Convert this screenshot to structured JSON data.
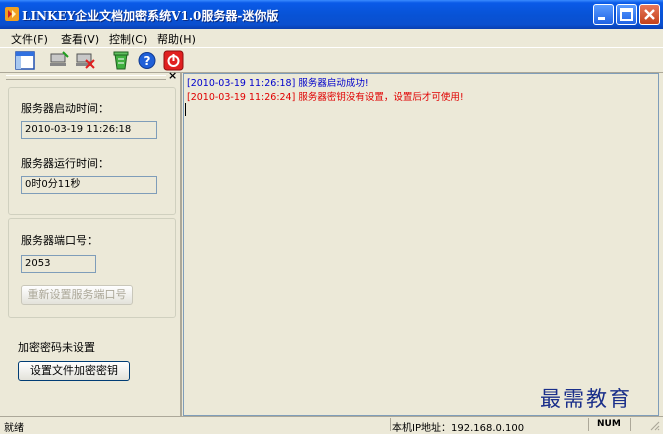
{
  "window": {
    "title": "LINKEY企业文档加密系统V1.0服务器-迷你版"
  },
  "menu": [
    {
      "label": "文件(F)"
    },
    {
      "label": "查看(V)"
    },
    {
      "label": "控制(C)"
    },
    {
      "label": "帮助(H)"
    }
  ],
  "toolbar": {
    "icons": [
      "window-icon",
      "server-connect-icon",
      "server-disconnect-icon",
      "recycle-icon",
      "help-icon",
      "power-icon"
    ]
  },
  "panel": {
    "close_glyph": "×",
    "start_time_label": "服务器启动时间：",
    "start_time_value": "2010-03-19 11:26:18",
    "run_time_label": "服务器运行时间：",
    "run_time_value": "0时0分11秒",
    "port_label": "服务器端口号：",
    "port_value": "2053",
    "reset_port_button": "重新设置服务端口号",
    "key_status": "加密密码未设置",
    "set_key_button": "设置文件加密密钥"
  },
  "log": [
    {
      "text": "[2010-03-19 11:26:18] 服务器启动成功!",
      "level": "info"
    },
    {
      "text": "[2010-03-19 11:26:24] 服务器密钥没有设置，设置后才可使用!",
      "level": "error"
    }
  ],
  "watermark": "最需教育",
  "status": {
    "left": "就绪",
    "ip": "本机IP地址：192.168.0.100",
    "num": "NUM"
  },
  "colors": {
    "titlebar": "#0853d6",
    "log_info": "#0000cc",
    "log_error": "#e00000"
  }
}
